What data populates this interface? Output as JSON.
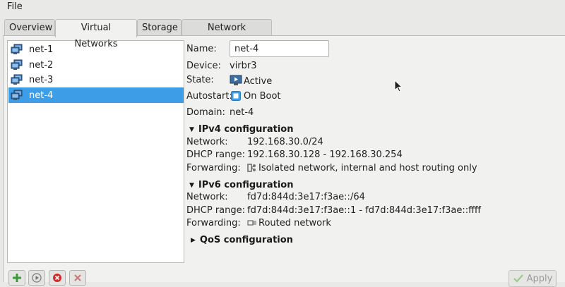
{
  "menubar": {
    "file": "File"
  },
  "tabs": [
    "Overview",
    "Virtual Networks",
    "Storage",
    "Network Interfaces"
  ],
  "networks": [
    {
      "label": "net-1",
      "selected": false
    },
    {
      "label": "net-2",
      "selected": false
    },
    {
      "label": "net-3",
      "selected": false
    },
    {
      "label": "net-4",
      "selected": true
    }
  ],
  "details": {
    "name_label": "Name:",
    "name_value": "net-4",
    "device_label": "Device:",
    "device_value": "virbr3",
    "state_label": "State:",
    "state_value": "Active",
    "autostart_label": "Autostart:",
    "autostart_value": "On Boot",
    "domain_label": "Domain:",
    "domain_value": "net-4"
  },
  "ipv4": {
    "title": "IPv4 configuration",
    "network_label": "Network:",
    "network_value": "192.168.30.0/24",
    "dhcp_label": "DHCP range:",
    "dhcp_value": "192.168.30.128 - 192.168.30.254",
    "forwarding_label": "Forwarding:",
    "forwarding_value": "Isolated network, internal and host routing only"
  },
  "ipv6": {
    "title": "IPv6 configuration",
    "network_label": "Network:",
    "network_value": "fd7d:844d:3e17:f3ae::/64",
    "dhcp_label": "DHCP range:",
    "dhcp_value": "fd7d:844d:3e17:f3ae::1 - fd7d:844d:3e17:f3ae::ffff",
    "forwarding_label": "Forwarding:",
    "forwarding_value": "Routed network"
  },
  "qos": {
    "title": "QoS configuration"
  },
  "buttons": {
    "apply": "Apply"
  },
  "icons": {
    "network": "network-monitor-icon",
    "state": "play-monitor-icon",
    "autostart": "checkbox-icon",
    "ipv4_forwarding": "isolated-network-icon",
    "ipv6_forwarding": "routed-network-icon",
    "add": "add-icon",
    "start": "start-icon",
    "stop": "stop-icon",
    "delete": "delete-icon",
    "apply": "checkmark-icon"
  },
  "colors": {
    "selection": "#3d9ee7",
    "add": "#3a9a3a",
    "stop": "#d42a2a",
    "delete": "#c97b78"
  }
}
